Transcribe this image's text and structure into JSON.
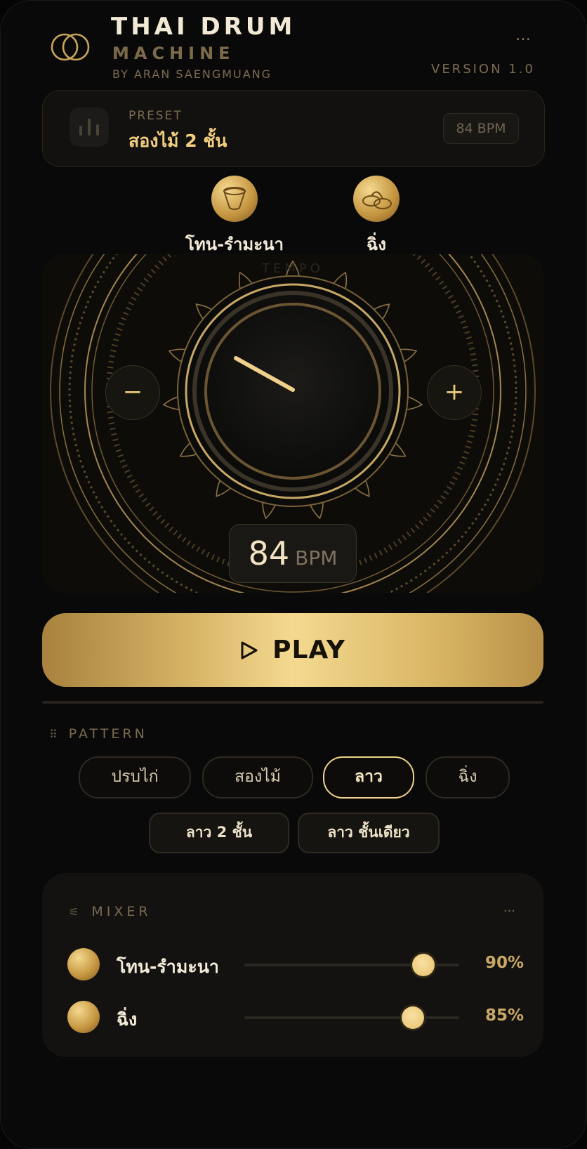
{
  "header": {
    "title_line1": "THAI DRUM",
    "title_line2": "MACHINE",
    "byline": "BY ARAN SAENGMUANG",
    "version": "VERSION 1.0",
    "menu_icon": "…"
  },
  "preset": {
    "label": "PRESET",
    "name": "สองไม้ 2 ชั้น",
    "bpm_badge": "84 BPM"
  },
  "instruments": [
    {
      "name": "โทน-รำมะนา",
      "icon": "thon-drum-icon"
    },
    {
      "name": "ฉิ่ง",
      "icon": "ching-cymbal-icon"
    }
  ],
  "tempo": {
    "label": "TEMPO",
    "bpm": "84",
    "unit": "BPM",
    "minus": "−",
    "plus": "+"
  },
  "play": {
    "label": "PLAY"
  },
  "pattern": {
    "title": "PATTERN",
    "options": [
      "ปรบไก่",
      "สองไม้",
      "ลาว",
      "ฉิ่ง"
    ],
    "active_index": 2,
    "variants": [
      "ลาว 2 ชั้น",
      "ลาว ชั้นเดียว"
    ]
  },
  "mixer": {
    "title": "MIXER",
    "menu_icon": "···",
    "tracks": [
      {
        "name": "โทน-รำมะนา",
        "volume": 0.9,
        "display": "90%"
      },
      {
        "name": "ฉิ่ง",
        "volume": 0.85,
        "display": "85%"
      }
    ]
  },
  "colors": {
    "accent_gold": "#f0d28d",
    "background": "#090909"
  }
}
